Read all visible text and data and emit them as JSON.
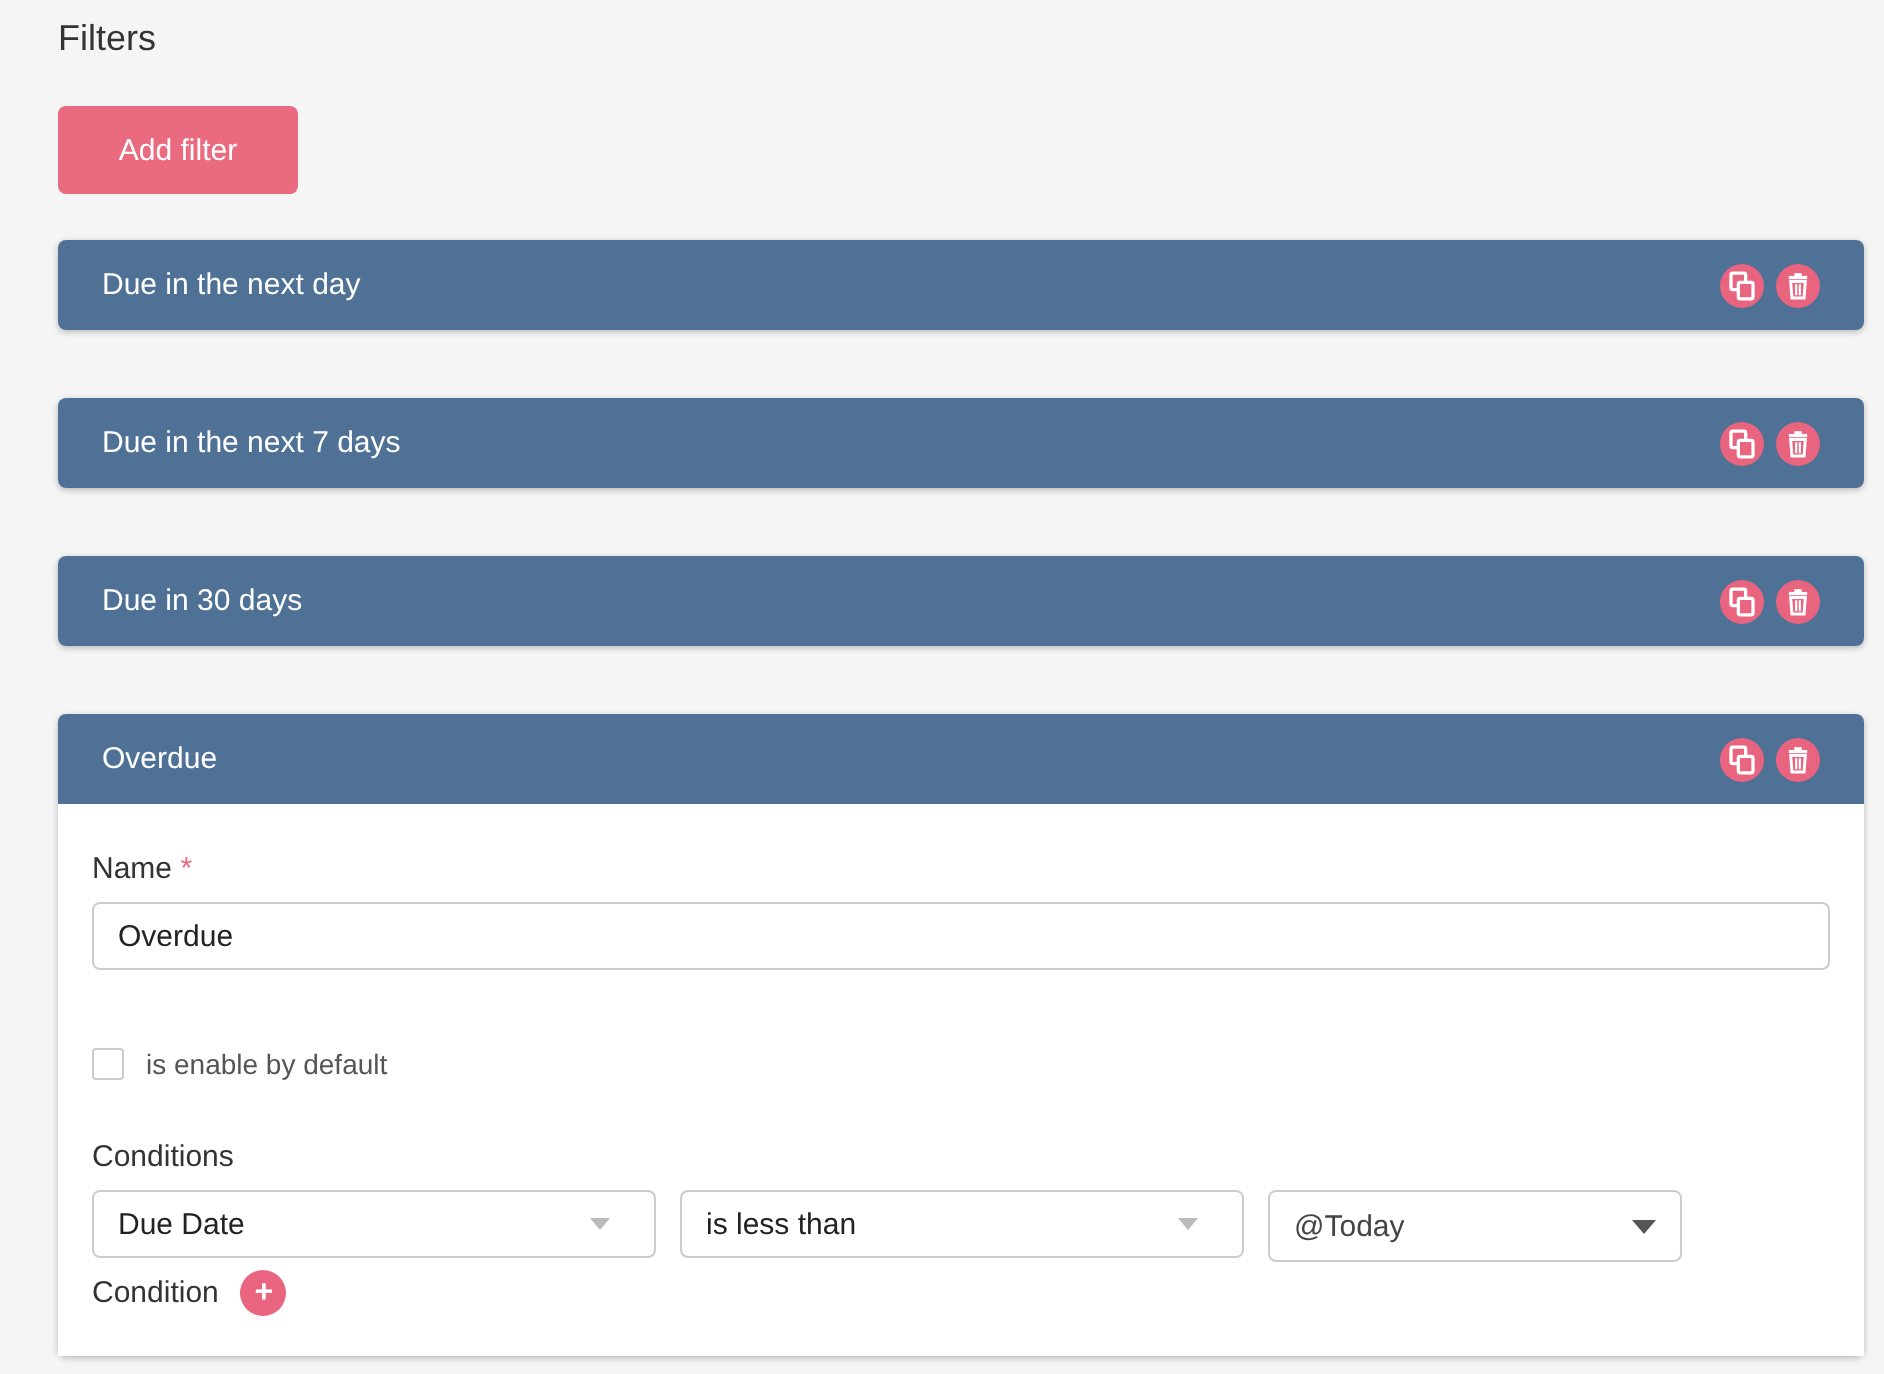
{
  "title": "Filters",
  "add_button": "Add filter",
  "filters": [
    {
      "name": "Due in the next day",
      "expanded": false
    },
    {
      "name": "Due in the next 7 days",
      "expanded": false
    },
    {
      "name": "Due in 30 days",
      "expanded": false
    },
    {
      "name": "Overdue",
      "expanded": true
    }
  ],
  "editor": {
    "name_label": "Name",
    "required_mark": "*",
    "name_value": "Overdue",
    "checkbox": {
      "label": "is enable by default",
      "checked": false
    },
    "conditions_label": "Conditions",
    "conditions": [
      {
        "kind": "select",
        "value": "Due Date"
      },
      {
        "kind": "select",
        "value": "is less than"
      },
      {
        "kind": "combo",
        "value": "@Today"
      }
    ],
    "add_condition_label": "Condition",
    "add_condition_icon": "+"
  }
}
